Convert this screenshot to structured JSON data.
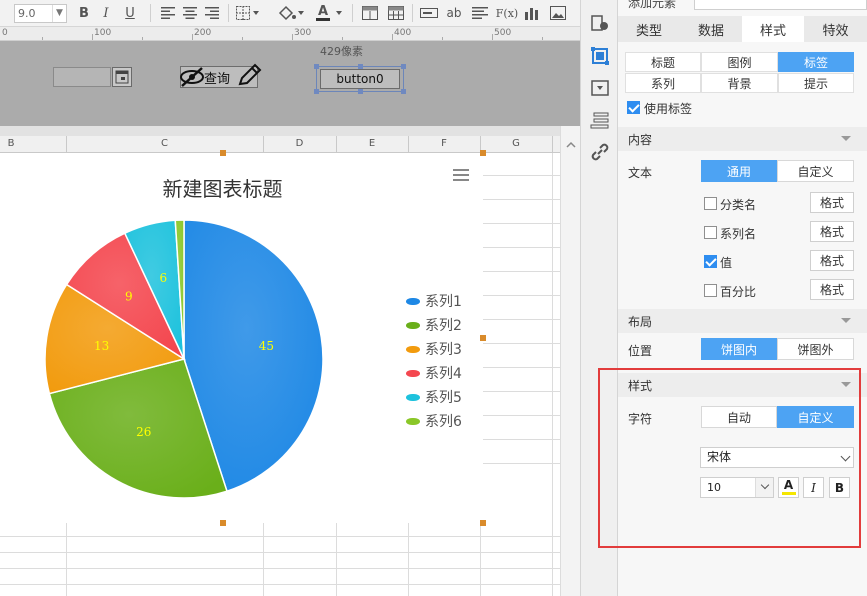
{
  "toolbar": {
    "font_size": "9.0",
    "bold": "B",
    "italic": "I",
    "underline": "U",
    "text_color_glyph": "A",
    "text_button_label": "ab",
    "formula_label": "F(x)"
  },
  "ruler": {
    "marks": [
      "100",
      "200",
      "300",
      "400",
      "500"
    ]
  },
  "param_pane": {
    "pixel_label": "429像素",
    "query_label": "查询",
    "button0_label": "button0"
  },
  "sheet": {
    "columns": [
      "B",
      "C",
      "D",
      "E",
      "F",
      "G"
    ]
  },
  "chart_data": {
    "type": "pie",
    "title": "新建图表标题",
    "series": [
      {
        "name": "系列1",
        "value": 45,
        "color": "#1e88e5"
      },
      {
        "name": "系列2",
        "value": 26,
        "color": "#6aaf1a"
      },
      {
        "name": "系列3",
        "value": 13,
        "color": "#f29b0e"
      },
      {
        "name": "系列4",
        "value": 9,
        "color": "#f4474f"
      },
      {
        "name": "系列5",
        "value": 6,
        "color": "#1ec2dd"
      },
      {
        "name": "系列6",
        "value": 1,
        "color": "#8ac728"
      }
    ],
    "data_label_color": "#ffff00",
    "legend_position": "right"
  },
  "panel": {
    "top_label": "添加元素",
    "tabs": [
      "类型",
      "数据",
      "样式",
      "特效"
    ],
    "active_tab": "样式",
    "subtabs": [
      [
        "标题",
        "图例",
        "标签"
      ],
      [
        "系列",
        "背景",
        "提示"
      ]
    ],
    "active_subtab": "标签",
    "use_label": "使用标签",
    "content_section": "内容",
    "text_label": "文本",
    "text_modes": [
      "通用",
      "自定义"
    ],
    "options": [
      {
        "label": "分类名",
        "checked": false,
        "format": "格式"
      },
      {
        "label": "系列名",
        "checked": false,
        "format": "格式"
      },
      {
        "label": "值",
        "checked": true,
        "format": "格式"
      },
      {
        "label": "百分比",
        "checked": false,
        "format": "格式"
      }
    ],
    "layout_section": "布局",
    "position_label": "位置",
    "position_modes": [
      "饼图内",
      "饼图外"
    ],
    "style_section": "样式",
    "char_label": "字符",
    "char_modes": [
      "自动",
      "自定义"
    ],
    "font_family": "宋体",
    "font_size": "10",
    "font_color_glyph": "A",
    "italic_glyph": "I",
    "bold_glyph": "B"
  }
}
